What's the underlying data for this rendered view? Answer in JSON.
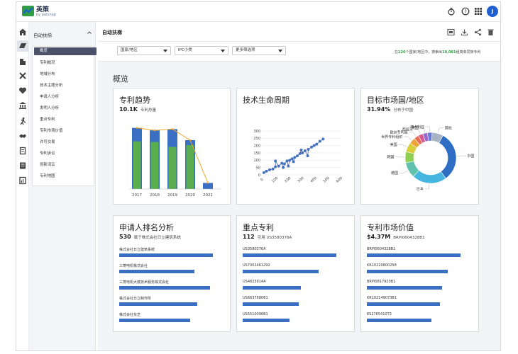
{
  "app": {
    "brand": "英策",
    "brand_sub": "by patsnap",
    "avatar_initial": "J"
  },
  "sidebar": {
    "section_label": "自动扶梯",
    "items": [
      {
        "label": "概览",
        "active": true
      },
      {
        "label": "专利概况"
      },
      {
        "label": "地域分布"
      },
      {
        "label": "技术主题分析"
      },
      {
        "label": "申请人分析"
      },
      {
        "label": "发明人分析"
      },
      {
        "label": "重点专利"
      },
      {
        "label": "专利市场价值"
      },
      {
        "label": "许可交易"
      },
      {
        "label": "专利诉讼"
      },
      {
        "label": "创新词云"
      },
      {
        "label": "专利地图"
      }
    ]
  },
  "page": {
    "title": "自动扶梯"
  },
  "filters": {
    "country": "国家/地区",
    "ipc": "IPC小类",
    "more": "更多筛选项",
    "summary_prefix": "在",
    "summary_countries": "126",
    "summary_mid": "个国家/地区中，搜索出",
    "summary_count": "10,081",
    "summary_suffix": "组简单同族专利"
  },
  "overview": {
    "title": "概览"
  },
  "cards": {
    "trend": {
      "title": "专利趋势",
      "metric": "10.1K",
      "metric_label": "专利总量"
    },
    "lifecycle": {
      "title": "技术生命周期"
    },
    "market": {
      "title": "目标市场国/地区",
      "metric": "31.94%",
      "metric_label": "分布于中国"
    },
    "applicant": {
      "title": "申请人排名分析",
      "metric": "530",
      "metric_label": "属于株式会社日立建筑系统",
      "rows": [
        {
          "label": "株式会社日立建筑系统",
          "value": 1.0
        },
        {
          "label": "三菱电机株式会社",
          "value": 0.8
        },
        {
          "label": "三菱电机大楼技术服务株式会社",
          "value": 0.97
        },
        {
          "label": "株式会社日立制作所",
          "value": 0.83
        },
        {
          "label": "株式会社东芝",
          "value": 0.76
        }
      ]
    },
    "key_patents": {
      "title": "重点专利",
      "metric": "112",
      "metric_label": "引用 US3580376A",
      "rows": [
        {
          "label": "US3580376A",
          "value": 1.0
        },
        {
          "label": "US7002461292",
          "value": 0.81
        },
        {
          "label": "US4823914A",
          "value": 0.62
        },
        {
          "label": "US6637580B1",
          "value": 0.6
        },
        {
          "label": "US5510096B1",
          "value": 0.5
        }
      ]
    },
    "market_value": {
      "title": "专利市场价值",
      "metric": "$4.37M",
      "metric_label": "BRPI0604328B1",
      "rows": [
        {
          "label": "BRPI0604328B1",
          "value": 1.0
        },
        {
          "label": "KR10220800258",
          "value": 0.86
        },
        {
          "label": "BRPI0817920B1",
          "value": 0.8
        },
        {
          "label": "KR102149073B1",
          "value": 0.78
        },
        {
          "label": "ES2765410T3",
          "value": 0.69
        }
      ]
    }
  },
  "chart_data": [
    {
      "type": "bar",
      "categories": [
        "2017",
        "2018",
        "2019",
        "2020",
        "2021"
      ],
      "series": [
        {
          "values": [
            100,
            96,
            98,
            80,
            10
          ],
          "color": "#3a6fc4"
        },
        {
          "values": [
            78,
            77,
            69,
            72,
            0
          ],
          "color": "#5aae4e"
        },
        {
          "values": [
            100,
            96,
            98,
            80,
            10
          ],
          "color": "#f0a72a",
          "kind": "line"
        }
      ],
      "ylim": [
        0,
        110
      ],
      "grid": false
    },
    {
      "type": "scatter",
      "x_ticks": [
        0,
        100,
        200,
        300,
        400,
        500,
        600
      ],
      "y_ticks": [
        0,
        50,
        100,
        150,
        200,
        250,
        300
      ],
      "xlim": [
        0,
        600
      ],
      "ylim": [
        0,
        300
      ],
      "points": [
        [
          10,
          15
        ],
        [
          30,
          25
        ],
        [
          55,
          35
        ],
        [
          80,
          40
        ],
        [
          100,
          55
        ],
        [
          125,
          60
        ],
        [
          150,
          80
        ],
        [
          170,
          75
        ],
        [
          190,
          95
        ],
        [
          210,
          100
        ],
        [
          230,
          110
        ],
        [
          250,
          120
        ],
        [
          270,
          130
        ],
        [
          290,
          145
        ],
        [
          310,
          150
        ],
        [
          330,
          165
        ],
        [
          355,
          175
        ],
        [
          380,
          190
        ],
        [
          400,
          200
        ],
        [
          420,
          210
        ],
        [
          445,
          230
        ],
        [
          470,
          245
        ],
        [
          100,
          95
        ],
        [
          160,
          50
        ],
        [
          240,
          90
        ],
        [
          300,
          170
        ],
        [
          350,
          130
        ],
        [
          200,
          60
        ]
      ],
      "grid": true
    },
    {
      "type": "pie",
      "donut": true,
      "labels": [
        "中国",
        "日本",
        "德国",
        "韩国",
        "美国",
        "世界专利组织",
        "欧洲专利局",
        "西班牙",
        "英国",
        "澳大利亚",
        "其他"
      ],
      "values": [
        31.94,
        22,
        10,
        7,
        6,
        4,
        3,
        3,
        3,
        3,
        7
      ],
      "colors": [
        "#2f6ec5",
        "#46b6e0",
        "#60c2ad",
        "#8fcf52",
        "#d8cf3c",
        "#f0a53a",
        "#ea6b57",
        "#d5588f",
        "#9a6ad0",
        "#6c7ad8",
        "#a8b4c4"
      ]
    }
  ],
  "colors": {
    "accent": "#3a6fc4",
    "green": "#2f9e44",
    "nav_active": "#4a5168"
  }
}
